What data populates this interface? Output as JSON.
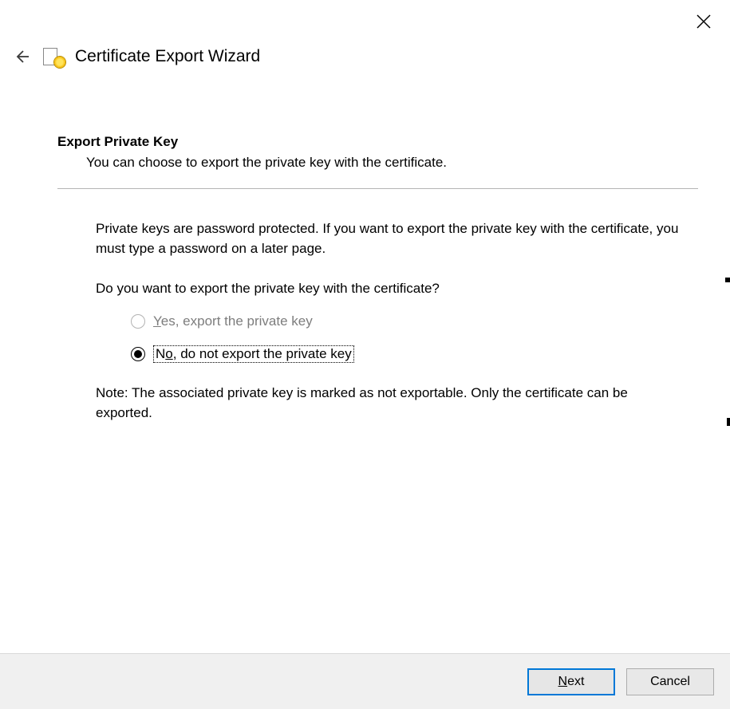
{
  "window": {
    "title": "Certificate Export Wizard"
  },
  "section": {
    "heading": "Export Private Key",
    "subheading": "You can choose to export the private key with the certificate."
  },
  "body": {
    "paragraph1": "Private keys are password protected. If you want to export the private key with the certificate, you must type a password on a later page.",
    "question": "Do you want to export the private key with the certificate?",
    "note": "Note: The associated private key is marked as not exportable. Only the certificate can be exported."
  },
  "options": {
    "yes_prefix": "Y",
    "yes_rest": "es, export the private key",
    "no_prefix": "N",
    "no_mid": "o",
    "no_rest": ", do not export the private key",
    "selected": "no",
    "yes_enabled": false
  },
  "buttons": {
    "next_prefix": "N",
    "next_rest": "ext",
    "cancel": "Cancel"
  }
}
